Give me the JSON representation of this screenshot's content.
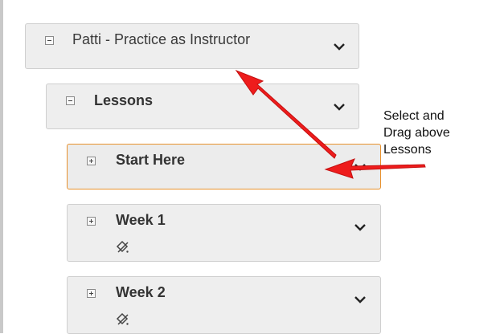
{
  "tree": {
    "root": {
      "title": "Patti - Practice as Instructor",
      "toggle": "collapse",
      "menu_icon": "chevron-down-icon"
    },
    "lessons": {
      "title": "Lessons",
      "toggle": "collapse",
      "menu_icon": "chevron-down-icon"
    },
    "items": [
      {
        "title": "Start Here",
        "toggle": "expand",
        "selected": true,
        "menu_icon": "chevron-down-icon"
      },
      {
        "title": "Week 1",
        "toggle": "expand",
        "selected": false,
        "status_icon": "visibility-toggle-icon",
        "menu_icon": "chevron-down-icon"
      },
      {
        "title": "Week 2",
        "toggle": "expand",
        "selected": false,
        "status_icon": "visibility-toggle-icon",
        "menu_icon": "chevron-down-icon"
      }
    ]
  },
  "annotation": {
    "lines": [
      "Select and",
      "Drag above",
      "Lessons"
    ],
    "arrow_color": "#ee1c1c"
  },
  "colors": {
    "selected_border": "#e8912c",
    "node_bg": "#eeeeee"
  }
}
